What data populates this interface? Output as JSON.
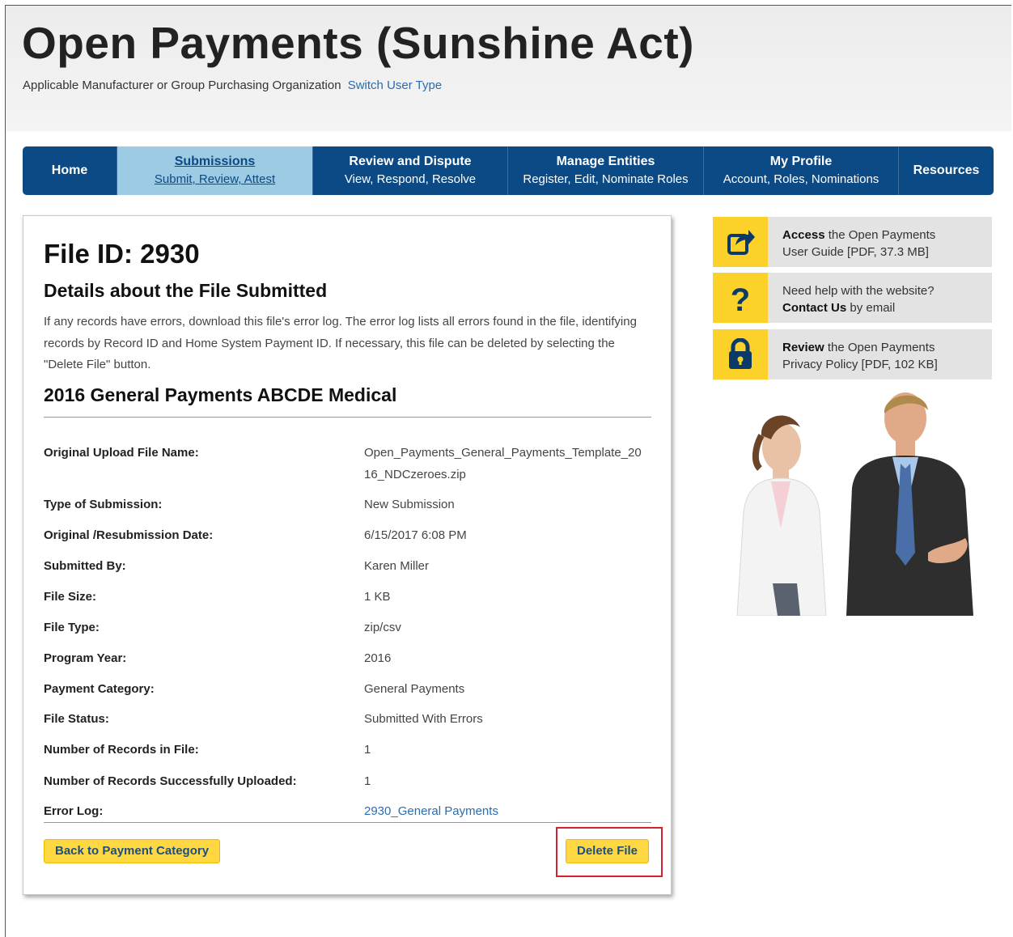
{
  "header": {
    "title": "Open Payments (Sunshine Act)",
    "user_type": "Applicable Manufacturer or Group Purchasing Organization",
    "switch_link": "Switch User Type"
  },
  "nav": {
    "home": "Home",
    "submissions": {
      "title": "Submissions",
      "sub": "Submit, Review, Attest"
    },
    "review": {
      "title": "Review and Dispute",
      "sub": "View, Respond, Resolve"
    },
    "entities": {
      "title": "Manage Entities",
      "sub": "Register, Edit, Nominate Roles"
    },
    "profile": {
      "title": "My Profile",
      "sub": "Account, Roles, Nominations"
    },
    "resources": "Resources"
  },
  "main": {
    "file_id": "File ID: 2930",
    "details_heading": "Details about the File Submitted",
    "description": "If any records have errors, download this file's error log. The error log lists all errors found in the file, identifying records by Record ID and Home System Payment ID. If necessary, this file can be deleted by selecting the \"Delete File\" button.",
    "subheading": "2016 General Payments ABCDE Medical",
    "fields": [
      {
        "label": "Original Upload File Name:",
        "value": "Open_Payments_General_Payments_Template_2016_NDCzeroes.zip"
      },
      {
        "label": "Type of Submission:",
        "value": "New Submission"
      },
      {
        "label": "Original /Resubmission Date:",
        "value": "6/15/2017 6:08 PM"
      },
      {
        "label": "Submitted By:",
        "value": "Karen Miller"
      },
      {
        "label": "File Size:",
        "value": "1 KB"
      },
      {
        "label": "File Type:",
        "value": "zip/csv"
      },
      {
        "label": "Program Year:",
        "value": "2016"
      },
      {
        "label": "Payment Category:",
        "value": "General Payments"
      },
      {
        "label": "File Status:",
        "value": "Submitted With Errors"
      },
      {
        "label": "Number of Records in File:",
        "value": "1"
      },
      {
        "label": "Number of Records Successfully Uploaded:",
        "value": "1"
      },
      {
        "label": "Error Log:",
        "value": "2930_General Payments"
      }
    ],
    "back_button": "Back to Payment Category",
    "delete_button": "Delete File"
  },
  "sidebar": {
    "guide": {
      "bold": "Access",
      "rest1": " the Open Payments",
      "line2": "User Guide [PDF, 37.3 MB]"
    },
    "help": {
      "line1": "Need help with the website?",
      "bold": "Contact Us",
      "rest2": " by email"
    },
    "privacy": {
      "bold": "Review",
      "rest1": " the Open Payments",
      "line2": "Privacy Policy [PDF, 102 KB]"
    }
  },
  "colors": {
    "nav_blue": "#0c4a85",
    "nav_active": "#9ccbe3",
    "button_yellow": "#ffd740",
    "link_blue": "#2b6cb0",
    "highlight_red": "#d3212d"
  },
  "icons": {
    "guide": "share-arrow-icon",
    "help": "question-mark-icon",
    "privacy": "lock-icon"
  }
}
